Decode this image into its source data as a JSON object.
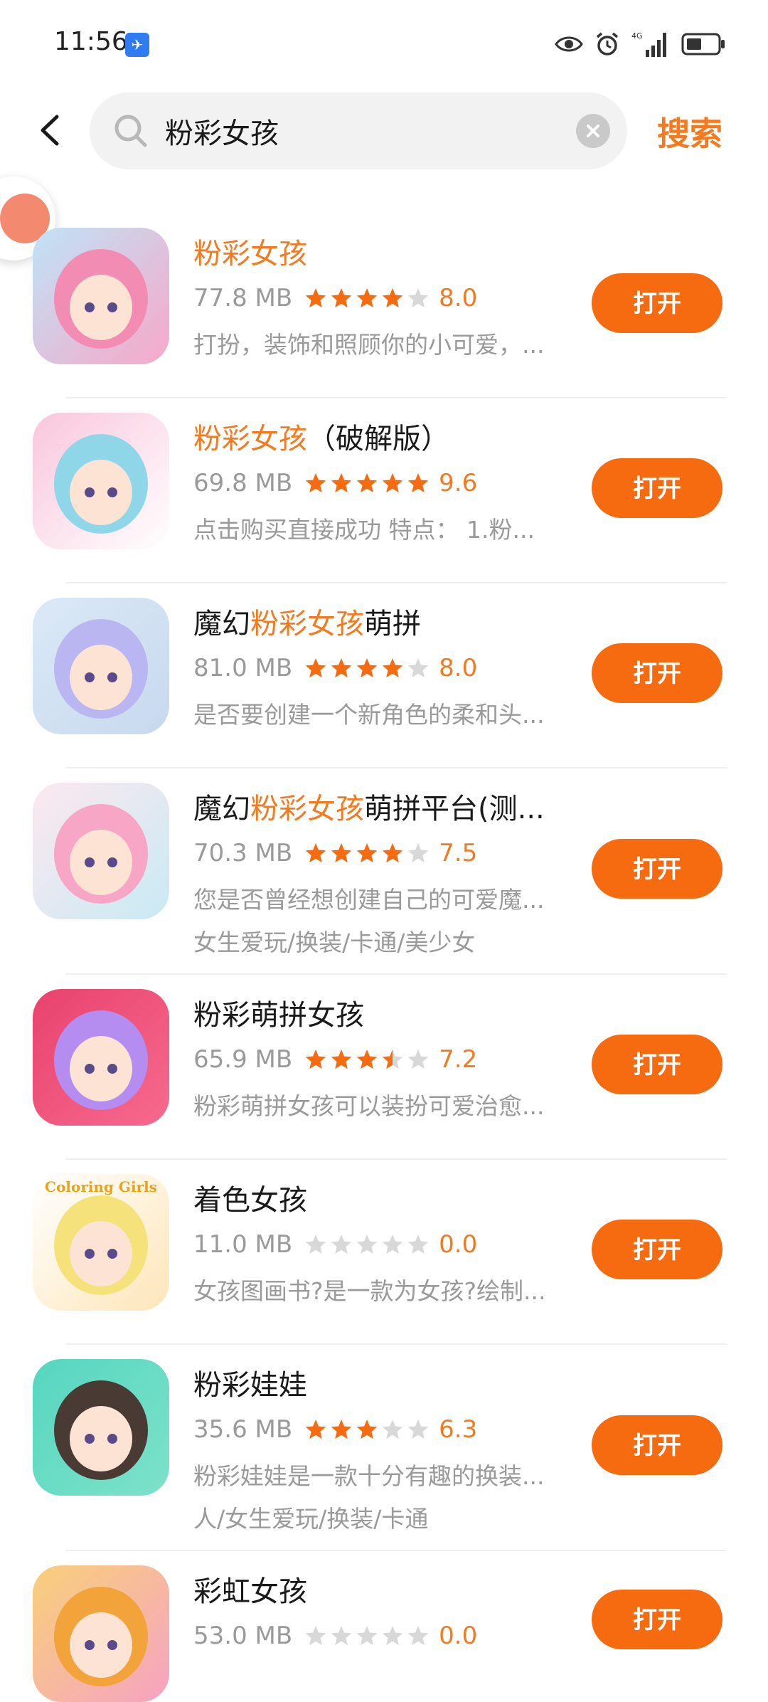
{
  "status_bar": {
    "time": "11:56",
    "app_icon": "notification-app-icon",
    "icons": [
      "eye-icon",
      "alarm-icon",
      "4g-signal-icon",
      "battery-icon"
    ]
  },
  "header": {
    "back_icon": "chevron-left-icon",
    "search_query": "粉彩女孩",
    "search_action": "搜索"
  },
  "colors": {
    "accent": "#f47a1f",
    "button": "#f76b10",
    "meta_text": "#9a9a9a"
  },
  "open_label": "打开",
  "results": [
    {
      "title_pre": "",
      "title_hl": "粉彩女孩",
      "title_post": "",
      "size": "77.8 MB",
      "stars": 4,
      "rating": "8.0",
      "desc": "打扮，装饰和照顾你的小可爱，...",
      "tags": "",
      "icon_name": "pink-girl-app-icon"
    },
    {
      "title_pre": "",
      "title_hl": "粉彩女孩",
      "title_post": "（破解版）",
      "size": "69.8 MB",
      "stars": 5,
      "rating": "9.6",
      "desc": "点击购买直接成功 特点：  1.粉...",
      "tags": "",
      "icon_name": "pastel-hair-girl-app-icon"
    },
    {
      "title_pre": "魔幻",
      "title_hl": "粉彩女孩",
      "title_post": "萌拼",
      "size": "81.0 MB",
      "stars": 4,
      "rating": "8.0",
      "desc": "是否要创建一个新角色的柔和头...",
      "tags": "",
      "icon_name": "magic-girl-app-icon"
    },
    {
      "title_pre": "魔幻",
      "title_hl": "粉彩女孩",
      "title_post": "萌拼平台(测...",
      "size": "70.3 MB",
      "stars": 4,
      "rating": "7.5",
      "desc": "您是否曾经想创建自己的可爱魔...",
      "tags": "女生爱玩/换装/卡通/美少女",
      "icon_name": "rainbow-hair-girl-app-icon"
    },
    {
      "title_pre": "粉彩萌拼女孩",
      "title_hl": "",
      "title_post": "",
      "size": "65.9 MB",
      "stars": 3.5,
      "rating": "7.2",
      "desc": "粉彩萌拼女孩可以装扮可爱治愈...",
      "tags": "",
      "icon_name": "cat-ear-girl-app-icon"
    },
    {
      "title_pre": "着色女孩",
      "title_hl": "",
      "title_post": "",
      "size": "11.0 MB",
      "stars": 0,
      "rating": "0.0",
      "desc": "女孩图画书?是一款为女孩?绘制...",
      "tags": "",
      "icon_name": "coloring-girls-app-icon",
      "icon_text": "Coloring Girls"
    },
    {
      "title_pre": "粉彩娃娃",
      "title_hl": "",
      "title_post": "",
      "size": "35.6 MB",
      "stars": 3,
      "rating": "6.3",
      "desc": "粉彩娃娃是一款十分有趣的换装...",
      "tags": "人/女生爱玩/换装/卡通",
      "icon_name": "doll-app-icon"
    },
    {
      "title_pre": "彩虹女孩",
      "title_hl": "",
      "title_post": "",
      "size": "53.0 MB",
      "stars": 0,
      "rating": "0.0",
      "desc": "",
      "tags": "",
      "icon_name": "rainbow-girl-app-icon"
    }
  ]
}
